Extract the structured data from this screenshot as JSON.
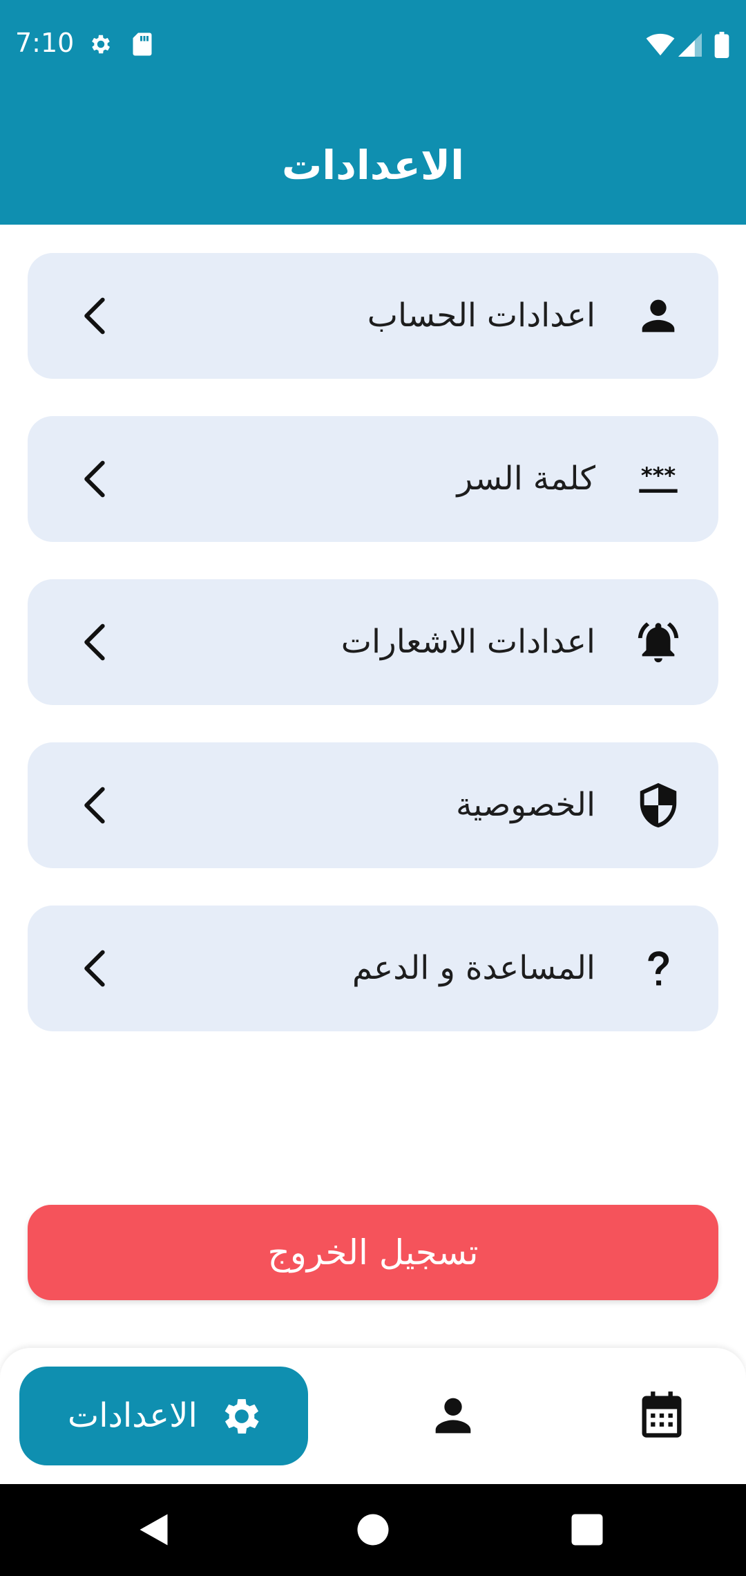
{
  "status_bar": {
    "time": "7:10",
    "icons_left": [
      "gear-icon",
      "sd-card-icon"
    ],
    "icons_right": [
      "wifi-icon",
      "signal-icon",
      "battery-icon"
    ]
  },
  "header": {
    "title": "الاعدادات"
  },
  "settings": {
    "items": [
      {
        "label": "اعدادات الحساب",
        "icon": "person-icon"
      },
      {
        "label": "كلمة السر",
        "icon": "password-icon"
      },
      {
        "label": "اعدادات الاشعارات",
        "icon": "bell-ringing-icon"
      },
      {
        "label": "الخصوصية",
        "icon": "shield-icon"
      },
      {
        "label": "المساعدة و الدعم",
        "icon": "question-icon"
      }
    ]
  },
  "logout": {
    "label": "تسجيل الخروج"
  },
  "bottom_nav": {
    "active_label": "الاعدادات",
    "items": [
      "settings-icon",
      "person-icon",
      "calendar-icon"
    ]
  },
  "colors": {
    "primary": "#0f8fb0",
    "card_bg": "#e6edf8",
    "logout": "#f5535b"
  }
}
